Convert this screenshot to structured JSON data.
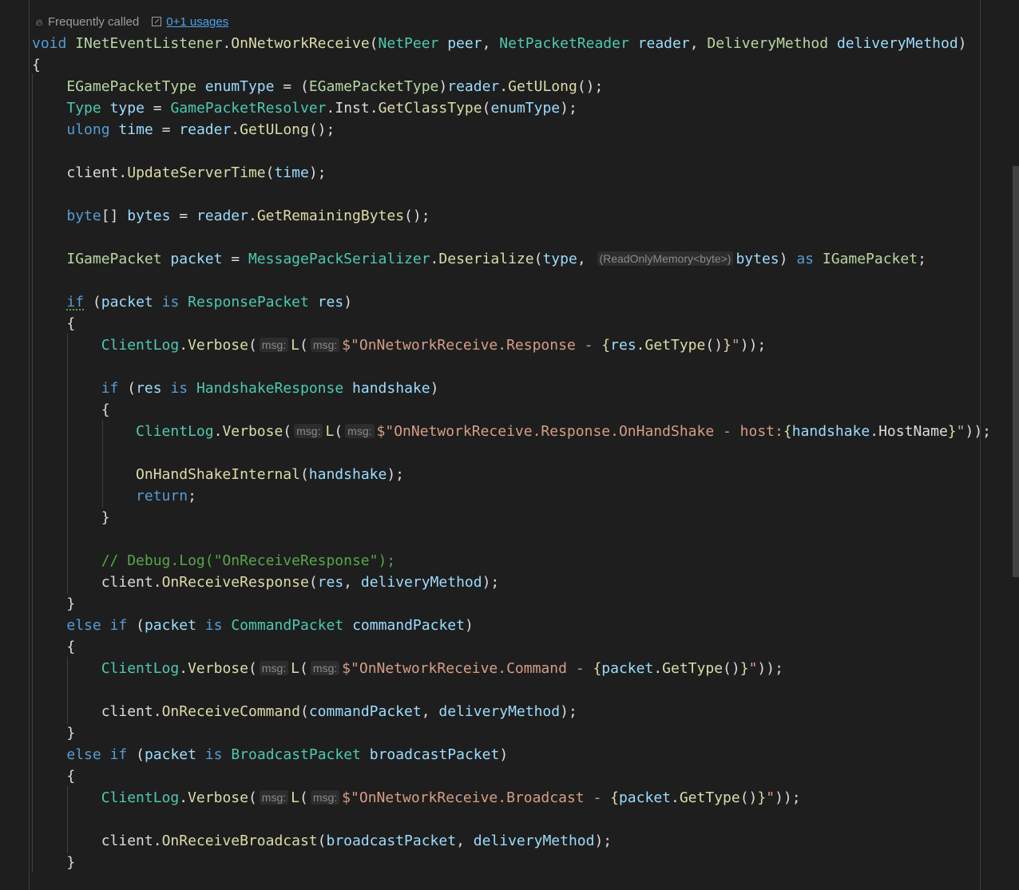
{
  "codelens": {
    "frequently_called": "Frequently called",
    "usages": "0+1 usages"
  },
  "code": {
    "sig_void": "void",
    "sig_iface": "INetEventListener",
    "sig_method": "OnNetworkReceive",
    "sig_t1": "NetPeer",
    "sig_p1": "peer",
    "sig_t2": "NetPacketReader",
    "sig_p2": "reader",
    "sig_t3": "DeliveryMethod",
    "sig_p3": "deliveryMethod",
    "l1_type": "EGamePacketType",
    "l1_var": "enumType",
    "l1_cast": "EGamePacketType",
    "l1_reader": "reader",
    "l1_call": "GetULong",
    "l2_type": "Type",
    "l2_var": "type",
    "l2_class": "GamePacketResolver",
    "l2_inst": "Inst",
    "l2_call": "GetClassType",
    "l2_arg": "enumType",
    "l3_type": "ulong",
    "l3_var": "time",
    "l3_reader": "reader",
    "l3_call": "GetULong",
    "l4_client": "client",
    "l4_call": "UpdateServerTime",
    "l4_arg": "time",
    "l5_type": "byte",
    "l5_var": "bytes",
    "l5_reader": "reader",
    "l5_call": "GetRemainingBytes",
    "l6_type": "IGamePacket",
    "l6_var": "packet",
    "l6_class": "MessagePackSerializer",
    "l6_call": "Deserialize",
    "l6_arg1": "type",
    "l6_hint": "(ReadOnlyMemory<byte>)",
    "l6_arg2": "bytes",
    "l6_as": "as",
    "l6_astype": "IGamePacket",
    "if1_kw": "if",
    "if1_var": "packet",
    "is": "is",
    "if1_type": "ResponsePacket",
    "if1_bind": "res",
    "log": "ClientLog",
    "verbose": "Verbose",
    "hint_msg": "msg:",
    "L": "L",
    "log1_str": "\"OnNetworkReceive.Response - ",
    "log1_var": "res",
    "gettype": "GetType",
    "if2_kw": "if",
    "if2_var": "res",
    "if2_type": "HandshakeResponse",
    "if2_bind": "handshake",
    "log2_str": "\"OnNetworkReceive.Response.OnHandShake - host:",
    "log2_var": "handshake",
    "log2_prop": "HostName",
    "hs_call": "OnHandShakeInternal",
    "hs_arg": "handshake",
    "return": "return",
    "comment": "// Debug.Log(\"OnReceiveResponse\");",
    "resp_client": "client",
    "resp_call": "OnReceiveResponse",
    "resp_arg1": "res",
    "resp_arg2": "deliveryMethod",
    "else_kw": "else",
    "elseif1_var": "packet",
    "elseif1_type": "CommandPacket",
    "elseif1_bind": "commandPacket",
    "log3_str": "\"OnNetworkReceive.Command - ",
    "log3_var": "packet",
    "cmd_client": "client",
    "cmd_call": "OnReceiveCommand",
    "cmd_arg1": "commandPacket",
    "cmd_arg2": "deliveryMethod",
    "elseif2_var": "packet",
    "elseif2_type": "BroadcastPacket",
    "elseif2_bind": "broadcastPacket",
    "log4_str": "\"OnNetworkReceive.Broadcast - ",
    "log4_var": "packet",
    "bc_client": "client",
    "bc_call": "OnReceiveBroadcast",
    "bc_arg1": "broadcastPacket",
    "bc_arg2": "deliveryMethod"
  }
}
